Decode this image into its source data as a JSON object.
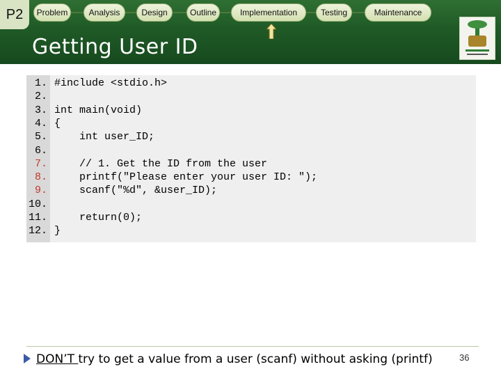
{
  "header": {
    "badge": "P2",
    "nav": [
      "Problem",
      "Analysis",
      "Design",
      "Outline",
      "Implementation",
      "Testing",
      "Maintenance"
    ]
  },
  "slide_title": "Getting User ID",
  "code": {
    "lines": [
      {
        "n": "1.",
        "text": "#include <stdio.h>"
      },
      {
        "n": "2.",
        "text": ""
      },
      {
        "n": "3.",
        "text": "int main(void)"
      },
      {
        "n": "4.",
        "text": "{"
      },
      {
        "n": "5.",
        "text": "    int user_ID;"
      },
      {
        "n": "6.",
        "text": ""
      },
      {
        "n": "7.",
        "text": "    // 1. Get the ID from the user"
      },
      {
        "n": "8.",
        "text": "    printf(\"Please enter your user ID: \");"
      },
      {
        "n": "9.",
        "text": "    scanf(\"%d\", &user_ID);"
      },
      {
        "n": "10.",
        "text": ""
      },
      {
        "n": "11.",
        "text": "    return(0);"
      },
      {
        "n": "12.",
        "text": "}"
      }
    ]
  },
  "footer": {
    "note_emph": "DON’T ",
    "note_rest": " try to get a value from a user (scanf) without asking (printf)",
    "page_number": "36"
  },
  "colors": {
    "header_green": "#1f5a26",
    "pill": "#d3e0b0",
    "highlight_line_numbers": "#c0392b"
  }
}
